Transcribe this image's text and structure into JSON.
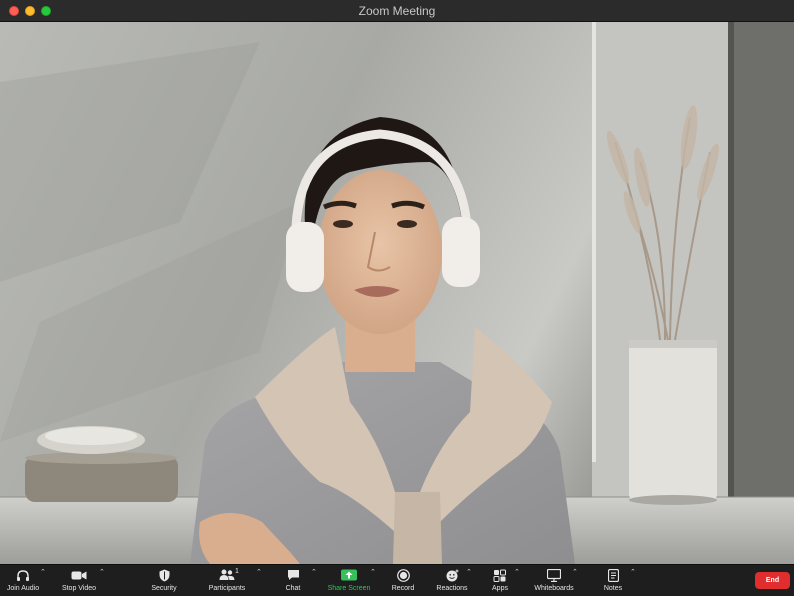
{
  "window": {
    "title": "Zoom Meeting"
  },
  "toolbar": {
    "join_audio": "Join Audio",
    "stop_video": "Stop Video",
    "security": "Security",
    "participants": "Participants",
    "participants_count": "1",
    "chat": "Chat",
    "share_screen": "Share Screen",
    "record": "Record",
    "reactions": "Reactions",
    "apps": "Apps",
    "whiteboards": "Whiteboards",
    "notes": "Notes",
    "end": "End"
  },
  "colors": {
    "share_screen": "#35c05a",
    "end_button": "#e02d2d",
    "toolbar_bg": "#1e1e1e"
  },
  "icons": [
    "headphones-icon",
    "video-camera-icon",
    "shield-icon",
    "people-icon",
    "chat-bubble-icon",
    "share-arrow-icon",
    "record-icon",
    "reaction-smile-icon",
    "apps-icon",
    "whiteboard-icon",
    "notes-icon"
  ]
}
